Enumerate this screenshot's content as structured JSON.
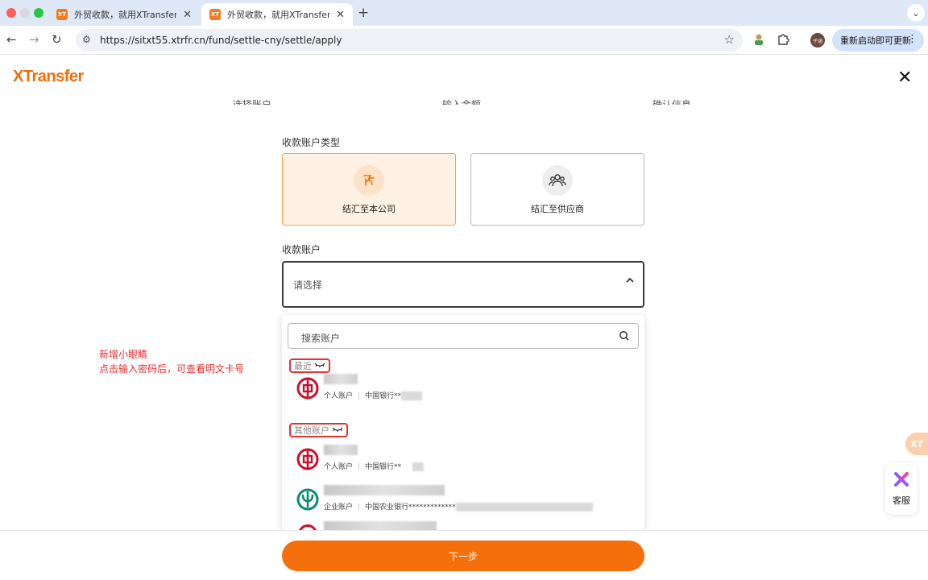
{
  "browser": {
    "tabs": [
      {
        "favicon": "XT",
        "title": "外贸收款，就用XTransfer！",
        "close": "✕"
      },
      {
        "favicon": "XT",
        "title": "外贸收款，就用XTransfer！",
        "close": "✕"
      }
    ],
    "new_tab": "+",
    "tab_menu": "⌄",
    "url": "https://sitxt55.xtrfr.cn/fund/settle-cny/settle/apply",
    "update_label": "重新启动即可更新",
    "profile_initials": "子涵"
  },
  "page": {
    "logo": "XTransfer",
    "close": "✕",
    "steps": [
      "选择账户",
      "输入金额",
      "确认信息"
    ],
    "account_type_label": "收款账户类型",
    "account_types": [
      {
        "label": "结汇至本公司",
        "icon": "company-icon",
        "selected": true
      },
      {
        "label": "结汇至供应商",
        "icon": "supplier-icon",
        "selected": false
      }
    ],
    "account_label": "收款账户",
    "select_placeholder": "请选择",
    "search_placeholder": "搜索账户",
    "groups": [
      {
        "title": "最近",
        "accounts": [
          {
            "bank_icon": "boc-logo-icon",
            "type": "个人账户",
            "bank": "中国银行**"
          }
        ]
      },
      {
        "title": "其他账户",
        "accounts": [
          {
            "bank_icon": "boc-logo-icon",
            "type": "个人账户",
            "bank": "中国银行**"
          },
          {
            "bank_icon": "abc-logo-icon",
            "type": "企业账户",
            "bank": "中国农业银行*************"
          }
        ]
      }
    ],
    "annotation": [
      "新增小眼睛",
      "点击输入密码后，可查看明文卡号"
    ],
    "next_button": "下一步",
    "float_badge": "XT",
    "service_label": "客服"
  },
  "colors": {
    "brand_orange": "#f5700c",
    "selected_card_bg": "#fff1e3",
    "annotation_red": "#e62e2e",
    "boc_red": "#c8102e",
    "abc_green": "#0a8a6e"
  }
}
